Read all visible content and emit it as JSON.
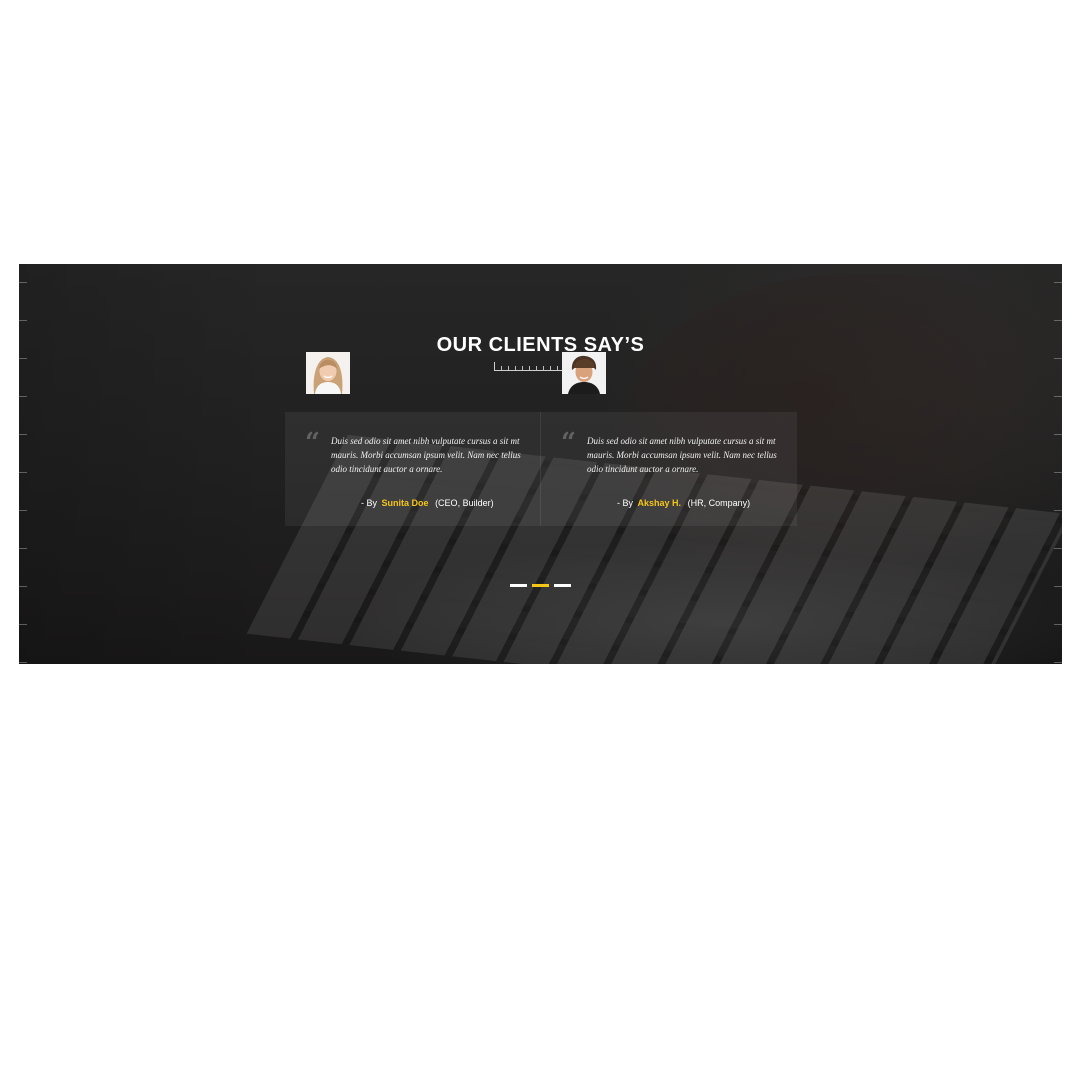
{
  "section": {
    "title": "OUR CLIENTS SAY’S"
  },
  "testimonials": [
    {
      "quote": "Duis sed odio sit amet nibh vulputate cursus a sit mt mauris. Morbi accumsan ipsum velit. Nam nec tellus odio tincidunt auctor a ornare.",
      "by_prefix": "- By",
      "name": "Sunita Doe",
      "role": "(CEO, Builder)",
      "avatar": "woman-portrait"
    },
    {
      "quote": "Duis sed odio sit amet nibh vulputate cursus a sit mt mauris. Morbi accumsan ipsum velit. Nam nec tellus odio tincidunt auctor a ornare.",
      "by_prefix": "- By",
      "name": "Akshay H.",
      "role": "(HR, Company)",
      "avatar": "man-portrait"
    }
  ],
  "carousel": {
    "pages": 3,
    "active_index": 1
  },
  "colors": {
    "accent": "#f5c518",
    "text": "#ffffff",
    "background": "#222222"
  },
  "icons": [
    "quote-icon"
  ]
}
